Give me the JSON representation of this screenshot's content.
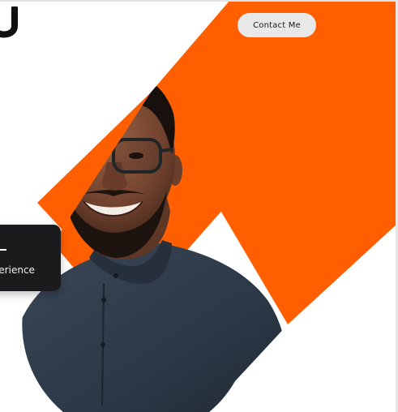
{
  "header": {
    "contact_label": "Contact Me",
    "logo_icon": "u-logo-icon"
  },
  "experience_card": {
    "value": "",
    "label": "Experience"
  },
  "colors": {
    "accent": "#ff5f00",
    "card_background": "#1b1b1d",
    "button_background": "#e8e8e8",
    "shirt": "#2f3b4b",
    "skin": "#7a4a34"
  },
  "hero": {
    "image_subject": "smiling man with glasses in dark shirt"
  }
}
